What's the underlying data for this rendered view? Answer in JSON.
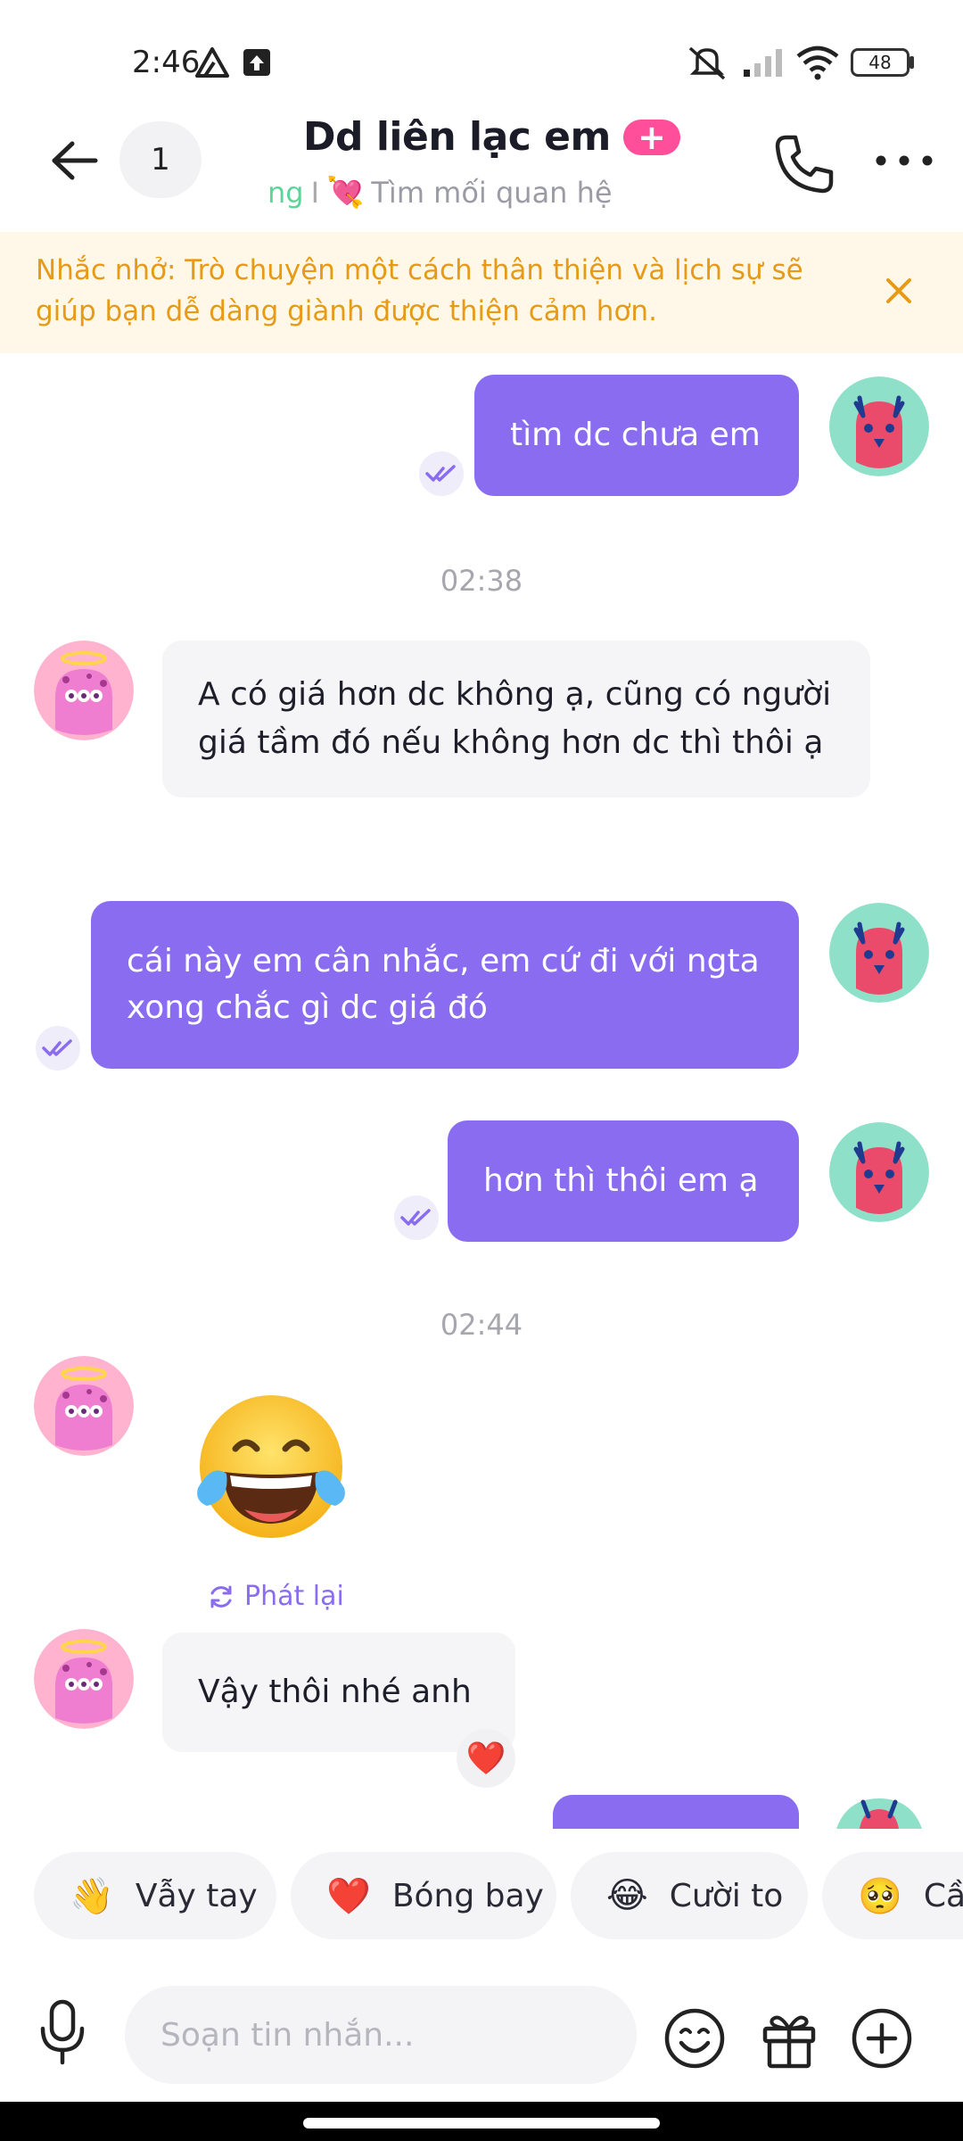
{
  "status_bar": {
    "time": "2:46",
    "battery": "48"
  },
  "header": {
    "unread_count": "1",
    "contact_name": "Dd liên lạc em",
    "subtitle_prefix": "ng",
    "subtitle_sep": "I",
    "subtitle_heart": "💘",
    "subtitle": "Tìm mối quan hệ"
  },
  "reminder": {
    "text": "Nhắc nhở: Trò chuyện một cách thân thiện và lịch sự sẽ giúp bạn dễ dàng giành được thiện cảm hơn."
  },
  "messages": {
    "m1": "tìm dc chưa em",
    "time1": "02:38",
    "m2": "A có giá hơn dc không ạ, cũng có người giá tầm đó nếu không hơn dc thì thôi ạ",
    "m3": "cái này em cân nhắc, em cứ đi với ngta xong chắc gì dc giá đó",
    "m4": "hơn thì thôi em ạ",
    "time2": "02:44",
    "m5_emoji": "😂",
    "replay_label": "Phát lại",
    "m6": "Vậy thôi nhé anh",
    "m6_reaction": "❤️"
  },
  "quick_replies": [
    {
      "emoji": "👋",
      "label": "Vẫy tay"
    },
    {
      "emoji": "❤️",
      "label": "Bóng bay"
    },
    {
      "emoji": "😂",
      "label": "Cười to"
    },
    {
      "emoji": "🥺",
      "label": "Cầu"
    }
  ],
  "composer": {
    "placeholder": "Soạn tin nhắn..."
  },
  "colors": {
    "accent": "#8a6cf0",
    "reminder_text": "#e69a16",
    "reminder_bg": "#fff8e9",
    "plus_badge": "#ff4f9a"
  }
}
